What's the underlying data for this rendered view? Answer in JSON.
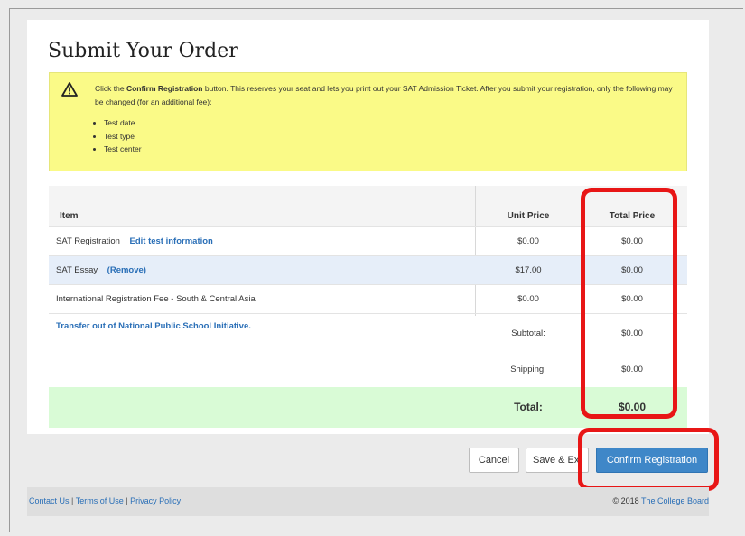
{
  "page": {
    "title": "Submit Your Order"
  },
  "notice": {
    "text_before": "Click the ",
    "text_bold": "Confirm Registration",
    "text_after": " button. This reserves your seat and lets you print out your SAT Admission Ticket. After you submit your registration, only the following may be changed (for an additional fee):",
    "items": [
      "Test date",
      "Test type",
      "Test center"
    ],
    "icon": "warning-triangle-icon"
  },
  "table": {
    "headers": {
      "item": "Item",
      "unit_price": "Unit Price",
      "total_price": "Total Price"
    },
    "rows": [
      {
        "item": "SAT Registration",
        "link": "Edit test information",
        "unit_price": "$0.00",
        "total_price": "$0.00"
      },
      {
        "item": "SAT Essay",
        "link": "(Remove)",
        "unit_price": "$17.00",
        "total_price": "$0.00"
      },
      {
        "item": "International Registration Fee - South & Central Asia",
        "link": "",
        "unit_price": "$0.00",
        "total_price": "$0.00"
      }
    ],
    "transfer_link": "Transfer out of National Public School Initiative.",
    "subtotal_label": "Subtotal:",
    "subtotal_value": "$0.00",
    "shipping_label": "Shipping:",
    "shipping_value": "$0.00",
    "total_label": "Total:",
    "total_value": "$0.00"
  },
  "buttons": {
    "cancel": "Cancel",
    "save_exit": "Save & Ex",
    "confirm": "Confirm Registration"
  },
  "footer": {
    "contact": "Contact Us",
    "terms": "Terms of Use",
    "privacy": "Privacy Policy",
    "sep": "|",
    "copyright": "© 2018 ",
    "brand": "The College Board"
  },
  "colors": {
    "highlight": "#e81616",
    "notice_bg": "#fafa87",
    "total_bg": "#d9fbd6",
    "link": "#2a6fb7",
    "primary_button": "#3f87c8"
  }
}
